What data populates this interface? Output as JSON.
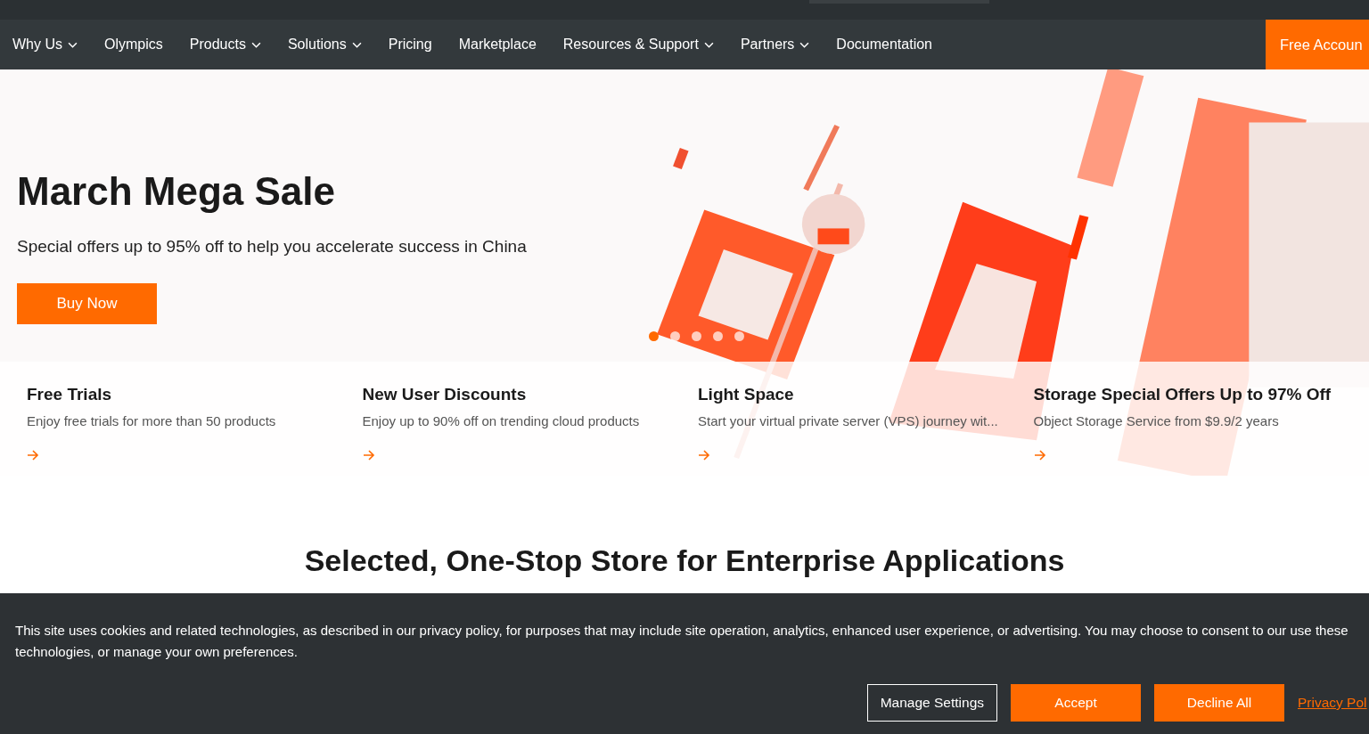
{
  "nav": {
    "items": [
      {
        "label": "Why Us",
        "dropdown": true
      },
      {
        "label": "Olympics",
        "dropdown": false
      },
      {
        "label": "Products",
        "dropdown": true
      },
      {
        "label": "Solutions",
        "dropdown": true
      },
      {
        "label": "Pricing",
        "dropdown": false
      },
      {
        "label": "Marketplace",
        "dropdown": false
      },
      {
        "label": "Resources & Support",
        "dropdown": true
      },
      {
        "label": "Partners",
        "dropdown": true
      },
      {
        "label": "Documentation",
        "dropdown": false
      }
    ],
    "cta": "Free Accoun"
  },
  "hero": {
    "title": "March Mega Sale",
    "subtitle": "Special offers up to 95% off to help you accelerate success in China",
    "button": "Buy Now",
    "dots": [
      {
        "selected": true
      },
      {
        "selected": false
      },
      {
        "selected": false
      },
      {
        "selected": false
      },
      {
        "selected": false
      }
    ]
  },
  "cards": [
    {
      "title": "Free Trials",
      "description": "Enjoy free trials for more than 50 products"
    },
    {
      "title": "New User Discounts",
      "description": "Enjoy up to 90% off on trending cloud products"
    },
    {
      "title": "Light Space",
      "description": "Start your virtual private server (VPS) journey wit..."
    },
    {
      "title": "Storage Special Offers Up to 97% Off",
      "description": "Object Storage Service from $9.9/2 years"
    }
  ],
  "section_heading": "Selected, One-Stop Store for Enterprise Applications",
  "cookie_banner": {
    "text": "This site uses cookies and related technologies, as described in our privacy policy, for purposes that may include site operation, analytics, enhanced user experience, or advertising. You may choose to consent to our use these technologies, or manage your own preferences.",
    "buttons": [
      {
        "label": "Manage Settings",
        "kind": "outline"
      },
      {
        "label": "Accept",
        "kind": "primary"
      },
      {
        "label": "Decline All",
        "kind": "primary"
      }
    ],
    "link": "Privacy Pol"
  }
}
